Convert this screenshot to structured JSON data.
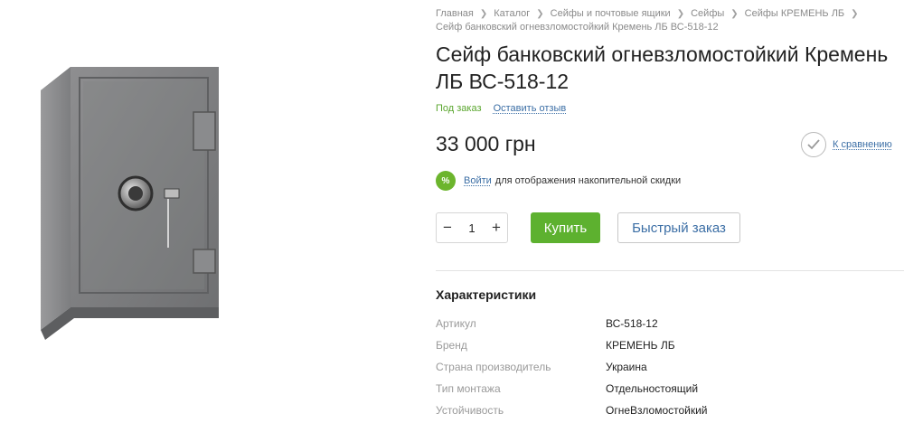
{
  "breadcrumb": {
    "items": [
      "Главная",
      "Каталог",
      "Сейфы и почтовые ящики",
      "Сейфы",
      "Сейфы КРЕМЕНЬ ЛБ"
    ],
    "current": "Сейф банковский огневзломостойкий Кремень ЛБ ВС-518-12"
  },
  "product": {
    "title": "Сейф банковский огневзломостойкий Кремень ЛБ ВС-518-12",
    "status": "Под заказ",
    "review_link": "Оставить отзыв",
    "price": "33 000 грн",
    "compare_label": "К сравнению",
    "discount_badge": "%",
    "discount_link": "Войти",
    "discount_text": "для отображения накопительной скидки"
  },
  "purchase": {
    "minus": "−",
    "quantity": "1",
    "plus": "+",
    "buy_label": "Купить",
    "quick_order_label": "Быстрый заказ"
  },
  "specs": {
    "title": "Характеристики",
    "rows": [
      {
        "key": "Артикул",
        "value": "ВС-518-12"
      },
      {
        "key": "Бренд",
        "value": "КРЕМЕНЬ ЛБ"
      },
      {
        "key": "Страна производитель",
        "value": "Украина"
      },
      {
        "key": "Тип монтажа",
        "value": "Отдельностоящий"
      },
      {
        "key": "Устойчивость",
        "value": "ОгнеВзломостойкий"
      }
    ]
  },
  "colors": {
    "accent_green": "#5db12f",
    "link_blue": "#3b6ea5",
    "status_green": "#5aa62e"
  }
}
